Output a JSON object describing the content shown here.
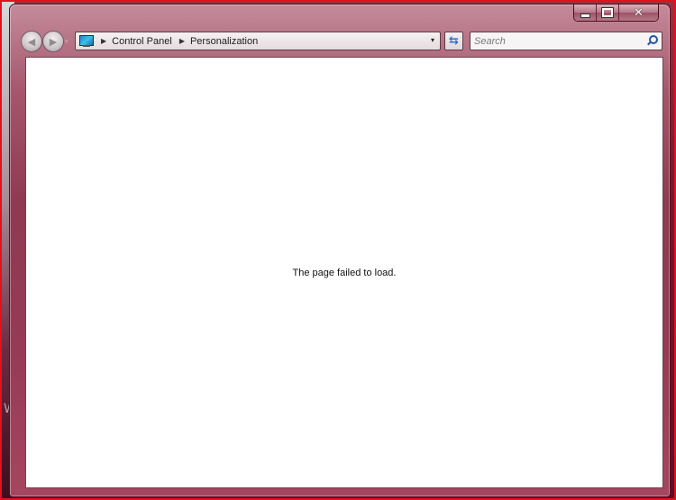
{
  "window": {
    "caption": {
      "minimize_icon": "minimize-icon",
      "maximize_icon": "maximize-icon",
      "close_glyph": "✕"
    }
  },
  "navigation": {
    "back_glyph": "◀",
    "forward_glyph": "▶",
    "recent_glyph": "▾",
    "address": {
      "icon": "control-panel-icon",
      "separator_glyph": "▶",
      "crumbs": [
        "Control Panel",
        "Personalization"
      ],
      "dropdown_glyph": "▾"
    },
    "refresh_glyph": "⇆",
    "search": {
      "placeholder": "Search",
      "value": ""
    }
  },
  "content": {
    "message": "The page failed to load."
  },
  "desktop": {
    "partial_text": "W"
  },
  "colors": {
    "frame_border": "#e2111c",
    "glass": "#8f3a52",
    "content_bg": "#ffffff"
  }
}
